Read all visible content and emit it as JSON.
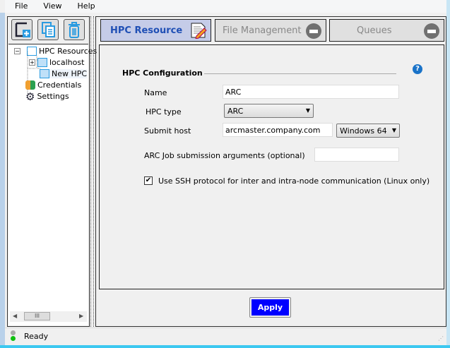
{
  "menu": [
    "File",
    "View",
    "Help"
  ],
  "toolbar": {
    "icons": [
      "new-icon",
      "copy-icon",
      "trash-icon"
    ]
  },
  "tree": {
    "root": "HPC Resources",
    "children": [
      "localhost",
      "New HPC"
    ],
    "items": [
      "Credentials",
      "Settings"
    ],
    "scroll_glyph": "III"
  },
  "tabs": [
    {
      "label": "HPC Resource",
      "active": true
    },
    {
      "label": "File Management"
    },
    {
      "label": "Queues"
    }
  ],
  "form": {
    "section": "HPC Configuration",
    "name_label": "Name",
    "name_value": "ARC",
    "type_label": "HPC type",
    "type_value": "ARC",
    "host_label": "Submit host",
    "host_value": "arcmaster.company.com",
    "os_value": "Windows 64",
    "args_label": "ARC Job submission arguments (optional)",
    "args_value": "",
    "ssh_label": "Use SSH protocol for inter and intra-node communication (Linux only)",
    "ssh_checked": true,
    "help": "?"
  },
  "apply_label": "Apply",
  "status": "Ready"
}
